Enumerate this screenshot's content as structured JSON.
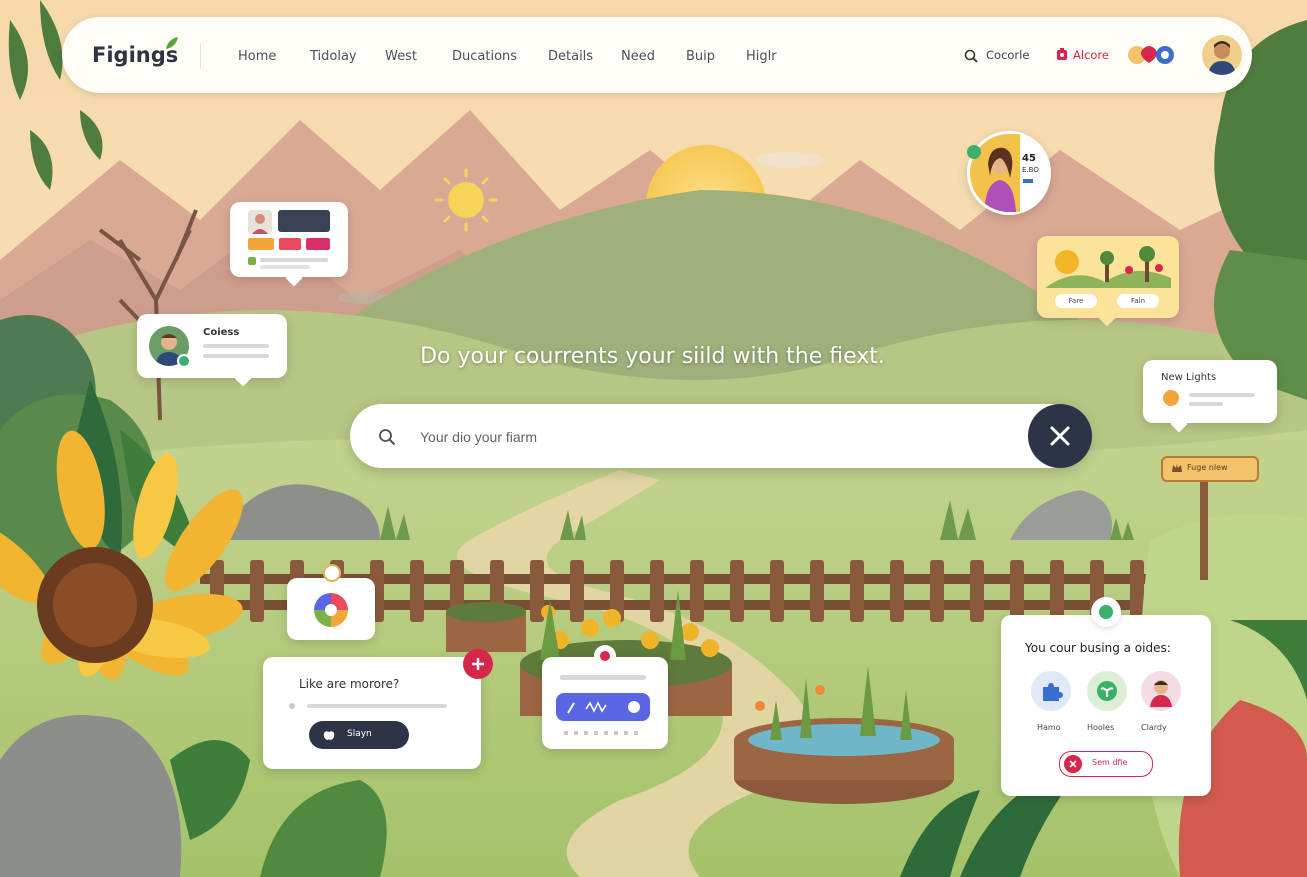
{
  "header": {
    "logo": "Figings",
    "nav": [
      "Home",
      "Tidolay",
      "West",
      "Ducations",
      "Details",
      "Need",
      "Buip",
      "Higlr"
    ],
    "search_label": "Cocorle",
    "alert_label": "Alcore"
  },
  "hero": {
    "headline": "Do your courrents your siild with the fiext.",
    "search_placeholder": "Your dio your fiarm"
  },
  "cards": {
    "colors_card": {
      "title": "Coiess"
    },
    "badge_card": {
      "line1": "45",
      "line2": "E.BO"
    },
    "scene_card": {
      "btn1": "Fare",
      "btn2": "Fain"
    },
    "lights_card": {
      "title": "New Lights"
    },
    "signpost": {
      "label": "Fuge nlew"
    },
    "like_card": {
      "title": "Like are morore?",
      "button": "Slayn"
    },
    "guides_card": {
      "title": "You cour busing a oides:",
      "items": [
        "Hamo",
        "Hooles",
        "Clardy"
      ],
      "button": "Sem dfie"
    }
  },
  "colors": {
    "accent": "#d7264b",
    "dark": "#2d3447",
    "sky": "#f6dcae",
    "grass": "#a9c46a",
    "purple_btn": "#5a66e3"
  }
}
